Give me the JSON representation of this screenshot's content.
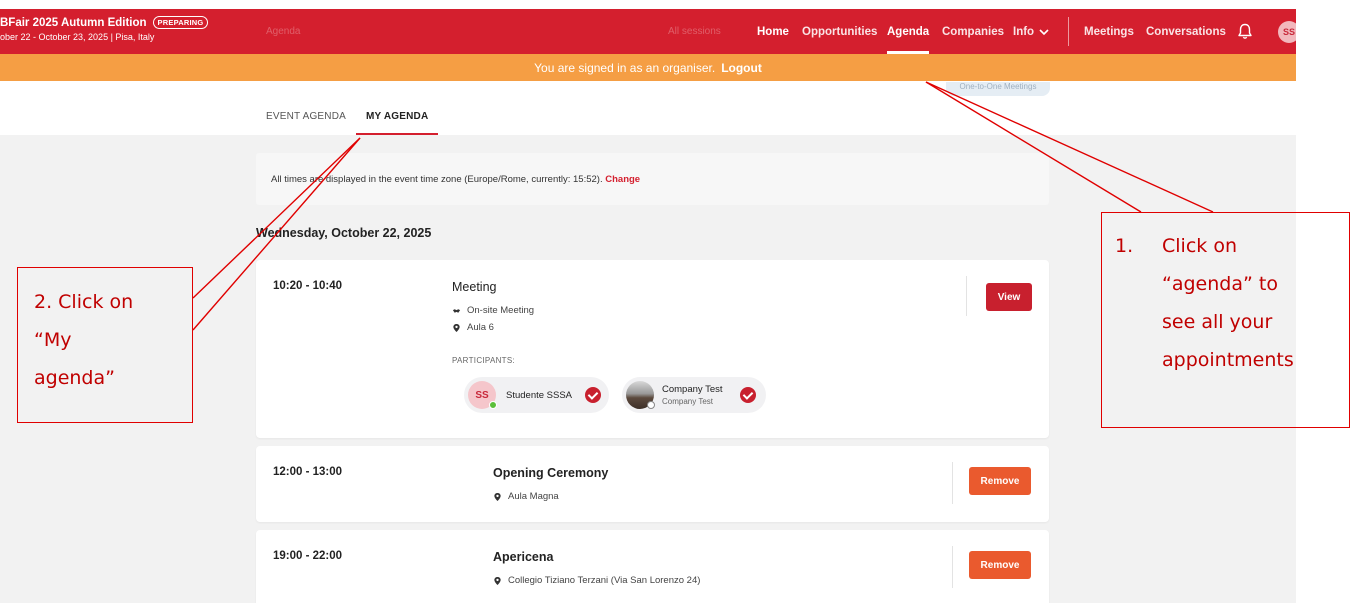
{
  "header": {
    "event_title": "BFair 2025 Autumn Edition",
    "status_badge": "PREPARING",
    "event_subtitle": "ober 22 - October 23, 2025 | Pisa, Italy",
    "ghost_left": "Agenda",
    "ghost_right": "All sessions",
    "nav": {
      "home": "Home",
      "opportunities": "Opportunities",
      "agenda": "Agenda",
      "companies": "Companies",
      "info": "Info",
      "meetings": "Meetings",
      "conversations": "Conversations"
    },
    "avatar_initials": "SS",
    "icons": {
      "bell": "bell-icon",
      "info_dropdown": "chevron-down-icon"
    },
    "colors": {
      "brand_red": "#d41f2e",
      "banner_orange": "#f59e44"
    }
  },
  "banner": {
    "text": "You are signed in as an organiser.",
    "logout": "Logout"
  },
  "ghost_pill": "One-to-One Meetings",
  "tabs": {
    "event_agenda": "EVENT AGENDA",
    "my_agenda": "MY AGENDA"
  },
  "notice": {
    "text_before": "All times are displayed in the event time zone (Europe/Rome, currently: 15:52). ",
    "change": "Change"
  },
  "day_heading": "Wednesday, October 22, 2025",
  "agenda_items": [
    {
      "time": "10:20 - 10:40",
      "title": "Meeting",
      "type": "On-site Meeting",
      "location": "Aula 6",
      "participants_label": "PARTICIPANTS:",
      "participants": [
        {
          "initials": "SS",
          "name": "Studente SSSA"
        },
        {
          "name": "Company Test",
          "sub": "Company Test"
        }
      ],
      "action": "View"
    },
    {
      "time": "12:00 - 13:00",
      "title": "Opening Ceremony",
      "location": "Aula Magna",
      "action": "Remove"
    },
    {
      "time": "19:00 - 22:00",
      "title": "Apericena",
      "location": "Collegio Tiziano Terzani (Via San Lorenzo 24)",
      "action": "Remove"
    }
  ],
  "annotations": {
    "step2": {
      "lines": [
        "2. Click on",
        "“My",
        "agenda”"
      ]
    },
    "step1": {
      "number": "1.",
      "lines": [
        "Click on",
        "“agenda” to",
        "see all your",
        "appointments"
      ]
    },
    "color": "#e00000"
  }
}
